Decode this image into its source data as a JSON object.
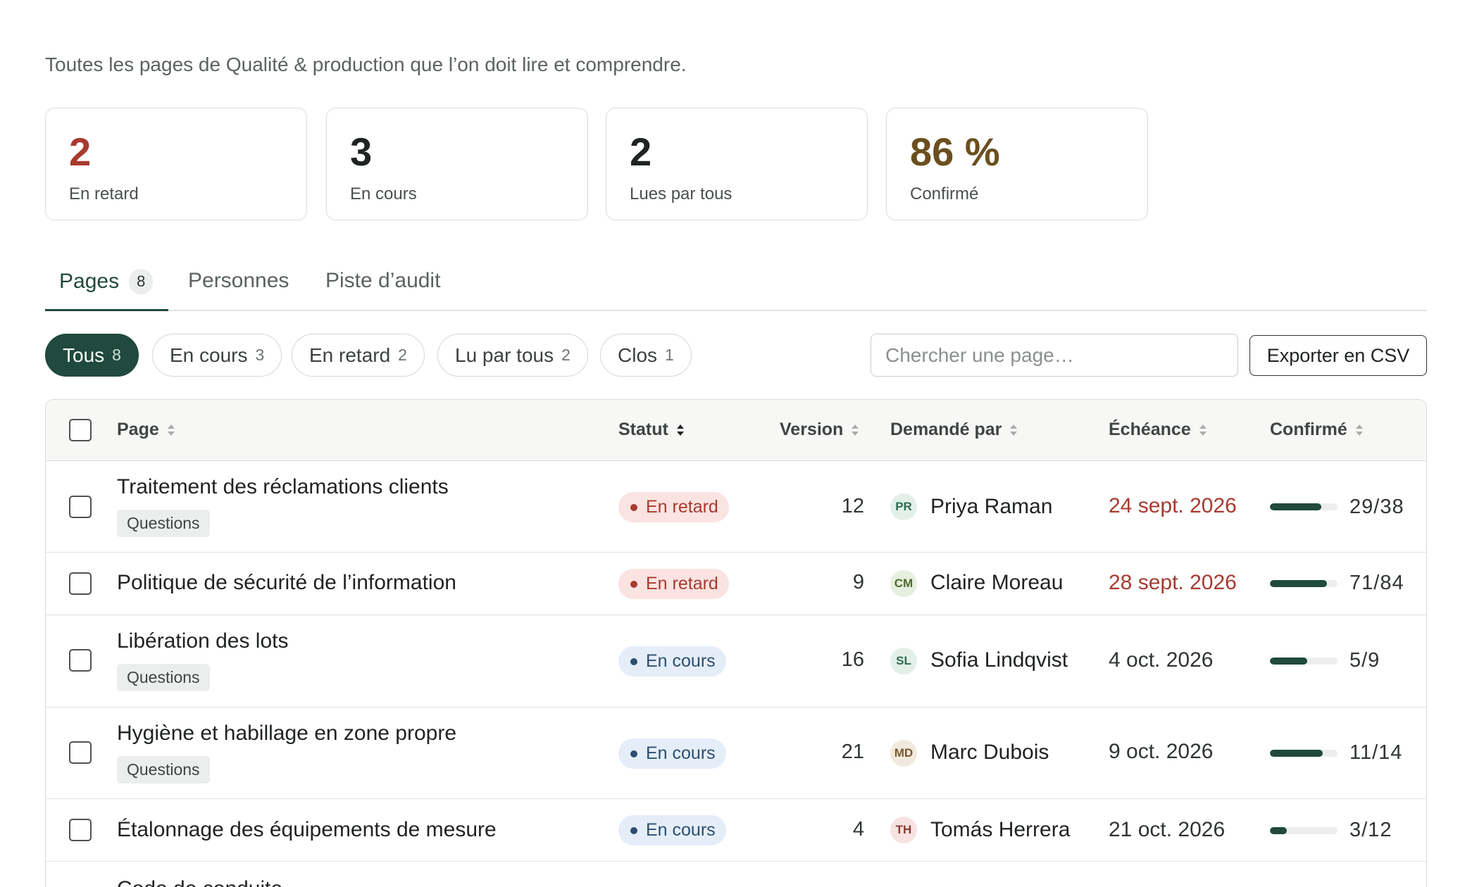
{
  "subtitle": "Toutes les pages de Qualité & production que l’on doit lire et comprendre.",
  "stats": [
    {
      "value": "2",
      "label": "En retard",
      "color": "#a83a2f"
    },
    {
      "value": "3",
      "label": "En cours",
      "color": "#1f2321"
    },
    {
      "value": "2",
      "label": "Lues par tous",
      "color": "#1f2321"
    },
    {
      "value": "86 %",
      "label": "Confirmé",
      "color": "#6b4f1f"
    }
  ],
  "tabs": [
    {
      "label": "Pages",
      "count": "8"
    },
    {
      "label": "Personnes"
    },
    {
      "label": "Piste d’audit"
    }
  ],
  "filters": [
    {
      "label": "Tous",
      "count": "8"
    },
    {
      "label": "En cours",
      "count": "3"
    },
    {
      "label": "En retard",
      "count": "2"
    },
    {
      "label": "Lu par tous",
      "count": "2"
    },
    {
      "label": "Clos",
      "count": "1"
    }
  ],
  "search": {
    "placeholder": "Chercher une page…"
  },
  "export_label": "Exporter en CSV",
  "columns": {
    "page": "Page",
    "status": "Statut",
    "version": "Version",
    "requested_by": "Demandé par",
    "due": "Échéance",
    "confirmed": "Confirmé"
  },
  "rows": [
    {
      "title": "Traitement des réclamations clients",
      "tag": "Questions",
      "status": "En retard",
      "version": "12",
      "initials": "PR",
      "person": "Priya Raman",
      "due": "24 sept. 2026",
      "confirmed": "29/38",
      "progress": 0.763
    },
    {
      "title": "Politique de sécurité de l’information",
      "tag": "",
      "status": "En retard",
      "version": "9",
      "initials": "CM",
      "person": "Claire Moreau",
      "due": "28 sept. 2026",
      "confirmed": "71/84",
      "progress": 0.845
    },
    {
      "title": "Libération des lots",
      "tag": "Questions",
      "status": "En cours",
      "version": "16",
      "initials": "SL",
      "person": "Sofia Lindqvist",
      "due": "4 oct. 2026",
      "confirmed": "5/9",
      "progress": 0.556
    },
    {
      "title": "Hygiène et habillage en zone propre",
      "tag": "Questions",
      "status": "En cours",
      "version": "21",
      "initials": "MD",
      "person": "Marc Dubois",
      "due": "9 oct. 2026",
      "confirmed": "11/14",
      "progress": 0.786
    },
    {
      "title": "Étalonnage des équipements de mesure",
      "tag": "",
      "status": "En cours",
      "version": "4",
      "initials": "TH",
      "person": "Tomás Herrera",
      "due": "21 oct. 2026",
      "confirmed": "3/12",
      "progress": 0.25
    },
    {
      "title": "Code de conduite",
      "tag": "",
      "status": "",
      "version": "",
      "initials": "",
      "person": "",
      "due": "",
      "confirmed": "",
      "progress": 0
    }
  ]
}
